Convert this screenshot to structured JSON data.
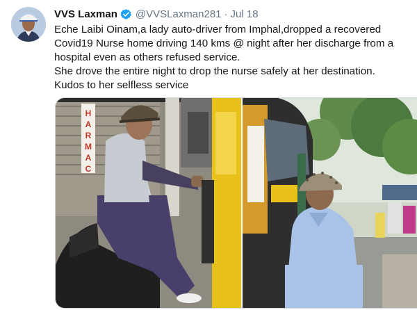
{
  "author": {
    "name": "VVS Laxman",
    "handle": "@VVSLaxman281",
    "separator": "·",
    "date": "Jul 18",
    "verified": true,
    "avatar_icon": "user-avatar-photo"
  },
  "tweet": {
    "lines": [
      "Eche Laibi Oinam,a lady auto-driver from Imphal,dropped a recovered",
      "Covid19 Nurse home driving 140 kms @ night after her discharge from a",
      "hospital even as others refused service.",
      "She drove the entire night to drop the nurse safely at her destination.",
      "Kudos to her selfless service"
    ]
  },
  "media": {
    "photo_1_icon": "woman-in-auto-rickshaw-photo",
    "photo_2_icon": "woman-beside-auto-rickshaw-photo",
    "shop_sign_text": "PHARMACY"
  },
  "colors": {
    "text": "#14171a",
    "secondary": "#657786",
    "verified": "#1da1f2",
    "rickshaw_yellow": "#e8c21a"
  }
}
